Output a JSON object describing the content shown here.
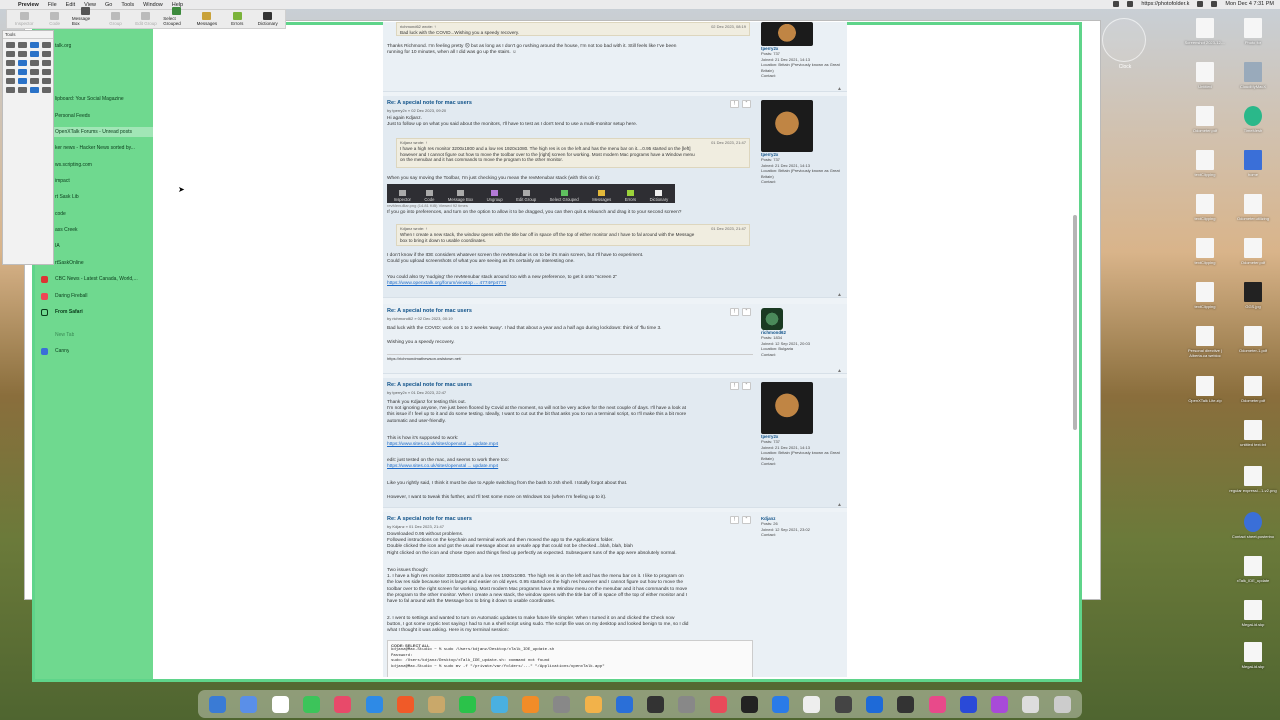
{
  "menubar": {
    "items": [
      "Preview",
      "File",
      "Edit",
      "View",
      "Go",
      "Tools",
      "Window",
      "Help"
    ],
    "url": "https://photofolder.k",
    "date_time": "Mon Dec 4 7:31 PM"
  },
  "toolbar": {
    "buttons": [
      "Inspector",
      "Code",
      "Message Box",
      "Group",
      "Edit Group",
      "Select Grouped",
      "Messages",
      "Errors",
      "Dictionary"
    ]
  },
  "tools_palette": {
    "title": "Tools"
  },
  "sidebar": {
    "items": [
      "talk.org",
      "lipboard: Your Social Magazine",
      "Personal Feeds",
      "OpenXTalk Forums - Unread posts",
      "ker news - Hacker News sorted by...",
      "ws.scripting.com",
      "impact",
      "rt Sask Lib",
      "code",
      "ass Creek",
      "IA",
      "rtSaskOnline",
      "CBC News - Latest Canada, World,...",
      "Daring Fireball",
      "From Safari",
      "New Tab",
      "Canny"
    ]
  },
  "posts": [
    {
      "quote_head": "richmond62 wrote: ↑",
      "quote_date": "02 Dec 2023, 08:19",
      "quote_text": "Bad luck with the COVID...Wishing you a speedy recovery.",
      "body": [
        "Thanks Richmond. I'm feeling pretty ☹ but as long as I don't go rushing around the house, I'm not too bad with it. Still feels like I've been",
        "running for 10 minutes, when all I did was go up the stairs. ☺"
      ],
      "profile": {
        "name": "tperry2x",
        "posts": "Posts: 737",
        "joined": "Joined: 21 Dec 2021, 14:13",
        "location": "Location: Britain (Previously known as Great Britain)",
        "contact": "Contact:"
      }
    },
    {
      "title": "Re: A special note for mac users",
      "by": "by tperry2x » 02 Dec 2023, 09:20",
      "body1": [
        "Hi again Kdjanz.",
        "Just to follow up on what you said about the monitors, I'll have to test as I don't tend to use a multi-monitor setup here."
      ],
      "quote1_head": "Kdjanz wrote: ↑",
      "quote1_date": "01 Dec 2023, 21:47",
      "quote1_text": [
        "I have a high res monitor 3200x1800 and a low res 1920x1080. The high res is on the left and has the menu bar on it....0.95 started on the [left]",
        "however and I cannot figure out how to move the toolbar over to the [right] screen for working. Most modern Mac programs have a Window menu",
        "on the menubar and it has commands to move the program to the other monitor."
      ],
      "body2": "When you say moving the Toolbar, I'm just checking you mean the revMenubar stack (with this on it):",
      "stack_buttons": [
        "Inspector",
        "Code",
        "Message Box",
        "Ungroup",
        "Edit Group",
        "Select Grouped",
        "Messages",
        "Errors",
        "Dictionary"
      ],
      "attachment": "revMenuBar.png (14.81 KiB) Viewed 92 times",
      "body3": "If you go into preferences, and turn on the option to allow it to be dragged, you can then quit & relaunch and drag it to your second screen?",
      "quote2_head": "Kdjanz wrote: ↑",
      "quote2_date": "01 Dec 2023, 21:47",
      "quote2_text": [
        "When I create a new stack, the window opens with the title bar off in space off the top of either monitor and I have to fal around with the Message",
        "box to bring it down to usable coordinates."
      ],
      "body4": [
        "I don't know if the IDE considers whatever screen the revMenubar is on to be it's main screen, but I'll have to experiment.",
        "Could you upload screenshots of what you are seeing as it's certainly an interesting one."
      ],
      "body5": "You could also try 'nudging' the revMenubar stack around too with a new preference, to get it onto \"screen 2\"",
      "link": "https://www.openxtalk.org/forum/viewtop ... 4774#p4774",
      "profile": {
        "name": "tperry2x",
        "posts": "Posts: 737",
        "joined": "Joined: 21 Dec 2021, 14:13",
        "location": "Location: Britain (Previously known as Great Britain)",
        "contact": "Contact:"
      }
    },
    {
      "title": "Re: A special note for mac users",
      "by": "by richmond62 » 02 Dec 2023, 00:19",
      "body1": "Bad luck with the COVID: work on 1 to 2 weeks 'away'. I had that about a year and a half ago during lockdown: think of 'flu time 3.",
      "body2": "Wishing you a speedy recovery.",
      "sig": "https://richmondmathewson.owlstown.net/",
      "profile": {
        "name": "richmond62",
        "posts": "Posts: 1834",
        "joined": "Joined: 12 Sep 2021, 20:03",
        "location": "Location: Bulgaria",
        "contact": "Contact:"
      }
    },
    {
      "title": "Re: A special note for mac users",
      "by": "by tperry2x » 01 Dec 2023, 22:47",
      "body1": [
        "Thank you Kdjanz for testing this out.",
        "I'm not ignoring anyone, I've just been floored by Covid at the moment, so will not be very active for the next couple of days. I'll have a look at",
        "this issue if I feel up to it and do some testing. Ideally, I want to cut out the bit that asks you to run a terminal script, so I'll make this a bit more",
        "automatic and user-friendly."
      ],
      "body2": "This is how it's supposed to work:",
      "link1": "https://www.sites.co.uk/sites/openxtal ... update.mp4",
      "body3": "edit: just tested on the mac, and seems to work there too:",
      "link2": "https://www.sites.co.uk/sites/openxtal ... update.mp4",
      "body4": "Like you rightly said, I think it must be due to Apple switching from the bash to zsh shell. I totally forgot about that.",
      "body5": "However, I want to tweak this further, and I'll test some more on Windows too (when I'm feeling up to it).",
      "profile": {
        "name": "tperry2x",
        "posts": "Posts: 737",
        "joined": "Joined: 21 Dec 2021, 14:13",
        "location": "Location: Britain (Previously known as Great Britain)",
        "contact": "Contact:"
      }
    },
    {
      "title": "Re: A special note for mac users",
      "by": "by Kdjanz » 01 Dec 2023, 21:47",
      "body1": [
        "Downloaded 0.95 without problems.",
        "Followed instructions on the keychain and terminal work and then moved the app to the Applications folder.",
        "Double clicked the icon and got the usual message about an unsafe app that could not be checked...blah, blah, blah",
        "Right clicked on the icon and chose Open and things fired up perfectly as expected. Subsequent runs of the app were absolutely normal."
      ],
      "body2": [
        "Two issues though:",
        "1. I have a high res monitor 3200x1800 and a low res 1920x1080. The high res is on the left and has the menu bar on it. I like to program on",
        "the low res side because text is larger and easier on old eyes. 0.95 started on the high res however and I cannot figure out how to move the",
        "toolbar over to the right screen for working. Most modern Mac programs have a Window menu on the menubar and it has commands to move",
        "the program to the other monitor. When I create a new stack, the window opens with the title bar off in space off the top of either monitor and I",
        "have to fal around with the Message box to bring it down to usable coordinates."
      ],
      "body3": [
        "2. I went to settings and wanted to turn on Automatic updates to make future life simpler. When I turned it on and clicked the Check now",
        "button, I got some cryptic text saying I had to run a shell script using sudo. The script file was on my desktop and looked benign to me, so I did",
        "what I thought it was asking. Here is my terminal session:"
      ],
      "code_header": "CODE: SELECT ALL",
      "code": [
        "kdjanz@Mac-Studio ~ % sudo /Users/kdjanz/Desktop/xTalk_IDE_update.sh",
        "Password:",
        "sudo: /Users/kdjanz/Desktop/xTalk_IDE_update.sh: command not found",
        "kdjanz@Mac-Studio ~ % sudo mv -f \"/private/var/folders/...\" \"/Applications/openxTalk.app\""
      ],
      "profile": {
        "name": "Kdjanz",
        "posts": "Posts: 26",
        "joined": "Joined: 12 Sep 2021, 23:02",
        "contact": "Contact:"
      }
    }
  ],
  "desktop": {
    "clock_label": "Clock",
    "icons": [
      "Screenshot 2023-12-...",
      "Photo for",
      "Untitled",
      "CloudMyMacX",
      "Odometer.pdf",
      "TimeMesh",
      "textClipping",
      "textClipping",
      "home",
      "textClipping",
      "Odometer.utilizing",
      "textClipping",
      "Odometer.pdf",
      "Personal directive | Alberta.ca webloc",
      "GGS.jpg",
      "OpenXTalk Lite.zip",
      "Odometer-1.pdf",
      "Odometer.pdf",
      "untitled text.txt",
      "regular expressi...1-v2.png",
      "Contact sheet.posterino",
      "xTalk_IDE_update",
      "MegaLid.skp",
      "MegaLid.skp"
    ]
  }
}
